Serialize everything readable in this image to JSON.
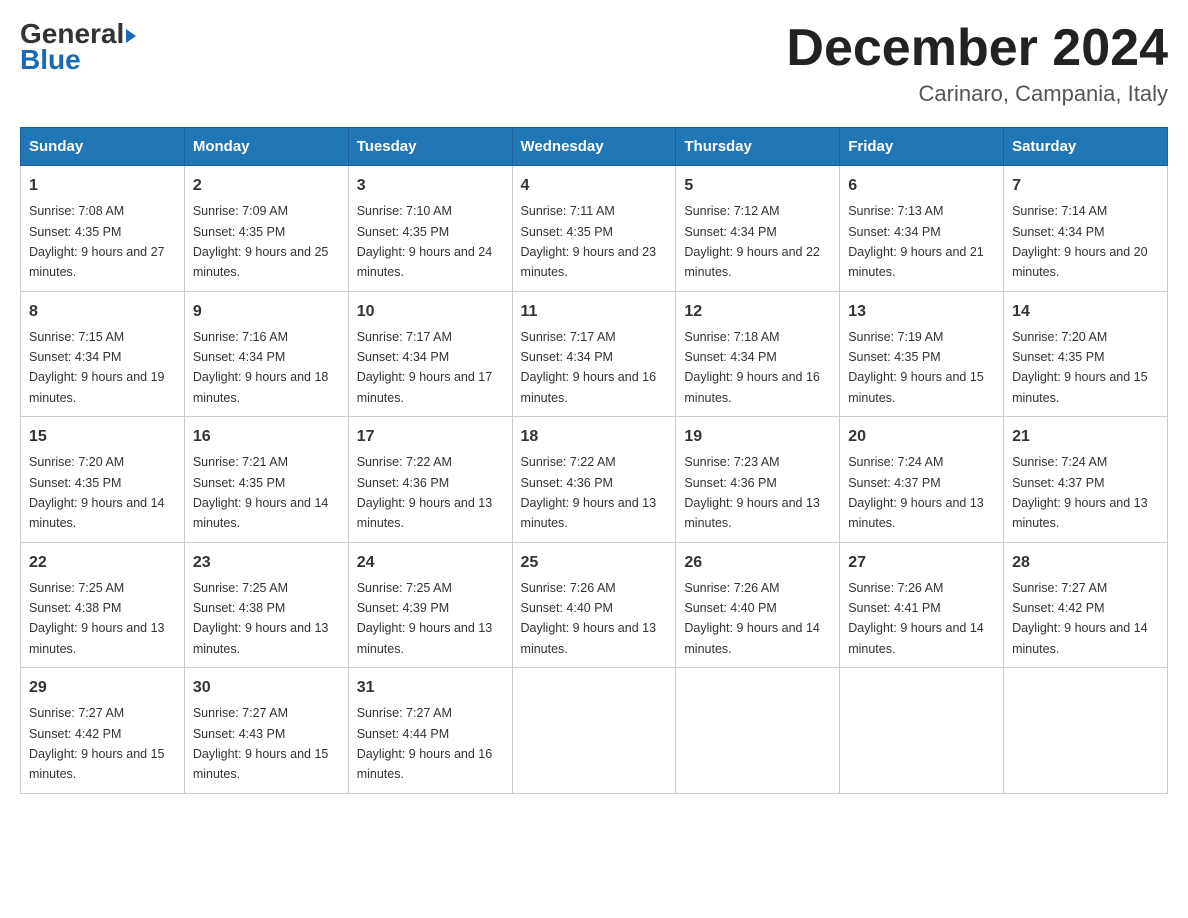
{
  "header": {
    "logo_line1": "General",
    "logo_line2": "Blue",
    "month_year": "December 2024",
    "location": "Carinaro, Campania, Italy"
  },
  "days_of_week": [
    "Sunday",
    "Monday",
    "Tuesday",
    "Wednesday",
    "Thursday",
    "Friday",
    "Saturday"
  ],
  "weeks": [
    [
      {
        "day": "1",
        "sunrise": "7:08 AM",
        "sunset": "4:35 PM",
        "daylight": "9 hours and 27 minutes."
      },
      {
        "day": "2",
        "sunrise": "7:09 AM",
        "sunset": "4:35 PM",
        "daylight": "9 hours and 25 minutes."
      },
      {
        "day": "3",
        "sunrise": "7:10 AM",
        "sunset": "4:35 PM",
        "daylight": "9 hours and 24 minutes."
      },
      {
        "day": "4",
        "sunrise": "7:11 AM",
        "sunset": "4:35 PM",
        "daylight": "9 hours and 23 minutes."
      },
      {
        "day": "5",
        "sunrise": "7:12 AM",
        "sunset": "4:34 PM",
        "daylight": "9 hours and 22 minutes."
      },
      {
        "day": "6",
        "sunrise": "7:13 AM",
        "sunset": "4:34 PM",
        "daylight": "9 hours and 21 minutes."
      },
      {
        "day": "7",
        "sunrise": "7:14 AM",
        "sunset": "4:34 PM",
        "daylight": "9 hours and 20 minutes."
      }
    ],
    [
      {
        "day": "8",
        "sunrise": "7:15 AM",
        "sunset": "4:34 PM",
        "daylight": "9 hours and 19 minutes."
      },
      {
        "day": "9",
        "sunrise": "7:16 AM",
        "sunset": "4:34 PM",
        "daylight": "9 hours and 18 minutes."
      },
      {
        "day": "10",
        "sunrise": "7:17 AM",
        "sunset": "4:34 PM",
        "daylight": "9 hours and 17 minutes."
      },
      {
        "day": "11",
        "sunrise": "7:17 AM",
        "sunset": "4:34 PM",
        "daylight": "9 hours and 16 minutes."
      },
      {
        "day": "12",
        "sunrise": "7:18 AM",
        "sunset": "4:34 PM",
        "daylight": "9 hours and 16 minutes."
      },
      {
        "day": "13",
        "sunrise": "7:19 AM",
        "sunset": "4:35 PM",
        "daylight": "9 hours and 15 minutes."
      },
      {
        "day": "14",
        "sunrise": "7:20 AM",
        "sunset": "4:35 PM",
        "daylight": "9 hours and 15 minutes."
      }
    ],
    [
      {
        "day": "15",
        "sunrise": "7:20 AM",
        "sunset": "4:35 PM",
        "daylight": "9 hours and 14 minutes."
      },
      {
        "day": "16",
        "sunrise": "7:21 AM",
        "sunset": "4:35 PM",
        "daylight": "9 hours and 14 minutes."
      },
      {
        "day": "17",
        "sunrise": "7:22 AM",
        "sunset": "4:36 PM",
        "daylight": "9 hours and 13 minutes."
      },
      {
        "day": "18",
        "sunrise": "7:22 AM",
        "sunset": "4:36 PM",
        "daylight": "9 hours and 13 minutes."
      },
      {
        "day": "19",
        "sunrise": "7:23 AM",
        "sunset": "4:36 PM",
        "daylight": "9 hours and 13 minutes."
      },
      {
        "day": "20",
        "sunrise": "7:24 AM",
        "sunset": "4:37 PM",
        "daylight": "9 hours and 13 minutes."
      },
      {
        "day": "21",
        "sunrise": "7:24 AM",
        "sunset": "4:37 PM",
        "daylight": "9 hours and 13 minutes."
      }
    ],
    [
      {
        "day": "22",
        "sunrise": "7:25 AM",
        "sunset": "4:38 PM",
        "daylight": "9 hours and 13 minutes."
      },
      {
        "day": "23",
        "sunrise": "7:25 AM",
        "sunset": "4:38 PM",
        "daylight": "9 hours and 13 minutes."
      },
      {
        "day": "24",
        "sunrise": "7:25 AM",
        "sunset": "4:39 PM",
        "daylight": "9 hours and 13 minutes."
      },
      {
        "day": "25",
        "sunrise": "7:26 AM",
        "sunset": "4:40 PM",
        "daylight": "9 hours and 13 minutes."
      },
      {
        "day": "26",
        "sunrise": "7:26 AM",
        "sunset": "4:40 PM",
        "daylight": "9 hours and 14 minutes."
      },
      {
        "day": "27",
        "sunrise": "7:26 AM",
        "sunset": "4:41 PM",
        "daylight": "9 hours and 14 minutes."
      },
      {
        "day": "28",
        "sunrise": "7:27 AM",
        "sunset": "4:42 PM",
        "daylight": "9 hours and 14 minutes."
      }
    ],
    [
      {
        "day": "29",
        "sunrise": "7:27 AM",
        "sunset": "4:42 PM",
        "daylight": "9 hours and 15 minutes."
      },
      {
        "day": "30",
        "sunrise": "7:27 AM",
        "sunset": "4:43 PM",
        "daylight": "9 hours and 15 minutes."
      },
      {
        "day": "31",
        "sunrise": "7:27 AM",
        "sunset": "4:44 PM",
        "daylight": "9 hours and 16 minutes."
      },
      null,
      null,
      null,
      null
    ]
  ]
}
